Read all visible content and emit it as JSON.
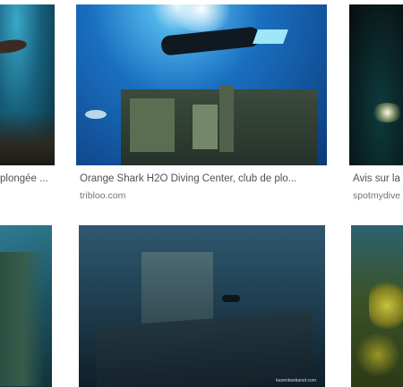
{
  "results": [
    {
      "caption": "plongée ...",
      "source": ""
    },
    {
      "caption": "Orange Shark H2O Diving Center, club de plo...",
      "source": "tribloo.com"
    },
    {
      "caption": "Avis sur la",
      "source": "spotmydive"
    }
  ],
  "row2": {
    "credit": "laurentwebanet.com"
  }
}
